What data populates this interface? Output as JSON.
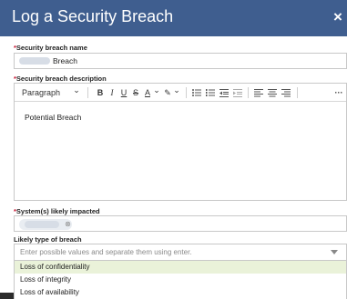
{
  "dialog": {
    "title": "Log a Security Breach",
    "close_glyph": "×"
  },
  "fields": {
    "name": {
      "required_mark": "*",
      "label": "Security breach name",
      "value_suffix": "Breach"
    },
    "description": {
      "required_mark": "*",
      "label": "Security breach description",
      "content": "Potential Breach"
    },
    "systems": {
      "required_mark": "*",
      "label": "System(s) likely impacted",
      "chip_remove_glyph": "⊗"
    },
    "breach_type": {
      "label": "Likely type of breach",
      "placeholder": "Enter possible values and separate them using enter.",
      "options": [
        "Loss of confidentiality",
        "Loss of integrity",
        "Loss of availability"
      ]
    }
  },
  "toolbar": {
    "paragraph_label": "Paragraph",
    "chevron": "⌄",
    "bold": "B",
    "italic": "I",
    "underline": "U",
    "strike": "S",
    "font_color": "A",
    "highlight": "✎",
    "more": "···"
  },
  "colors": {
    "header_bg": "#3f5e8f",
    "required_mark": "#c8102e",
    "option_highlight": "#eaf2d9"
  },
  "icons": {
    "close": "close-icon",
    "dropdown": "chevron-down-icon",
    "chip_remove": "remove-circle-icon"
  }
}
